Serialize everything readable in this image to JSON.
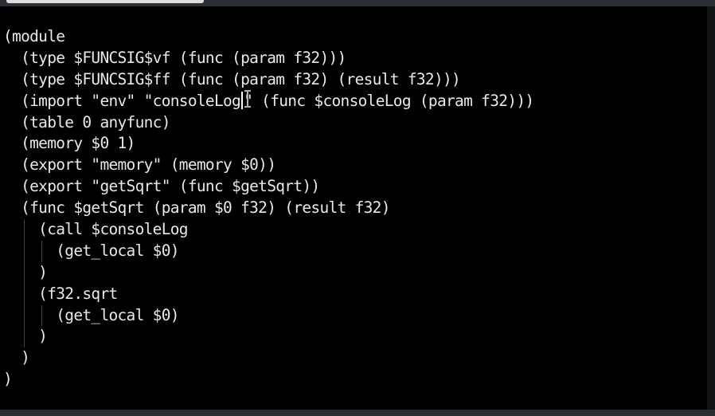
{
  "editor": {
    "lines": [
      "(module",
      "  (type $FUNCSIG$vf (func (param f32)))",
      "  (type $FUNCSIG$ff (func (param f32) (result f32)))",
      "  (import \"env\" \"consoleLog\" (func $consoleLog (param f32)))",
      "  (table 0 anyfunc)",
      "  (memory $0 1)",
      "  (export \"memory\" (memory $0))",
      "  (export \"getSqrt\" (func $getSqrt))",
      "  (func $getSqrt (param $0 f32) (result f32)",
      "    (call $consoleLog",
      "      (get_local $0)",
      "    )",
      "    (f32.sqrt",
      "      (get_local $0)",
      "    )",
      "  )",
      ")"
    ],
    "cursor_line": 3,
    "cursor_before": "  (import \"env\" \"consoleLog",
    "cursor_after": "\" (func $consoleLog (param f32)))"
  },
  "colors": {
    "background": "#000000",
    "text": "#e8e8e8",
    "indent_guide": "#3d4348",
    "cursor": "#ffffff"
  },
  "icons": {
    "mouse_pointer": "i-beam-cursor-icon"
  }
}
